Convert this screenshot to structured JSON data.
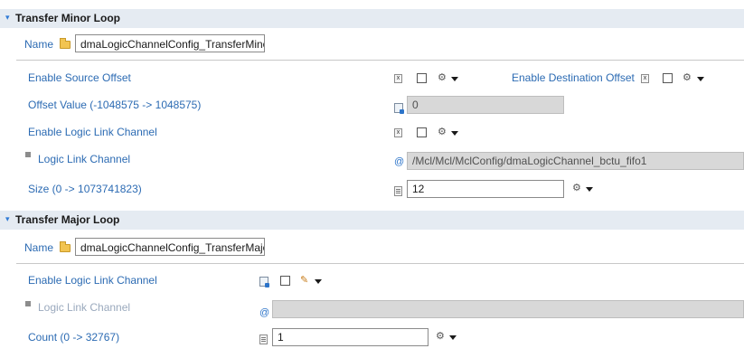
{
  "minor_loop": {
    "title": "Transfer Minor Loop",
    "name_label": "Name",
    "name_value": "dmaLogicChannelConfig_TransferMinor",
    "rows": {
      "enable_source_offset": "Enable Source Offset",
      "enable_destination_offset": "Enable Destination Offset",
      "offset_value": "Offset Value (-1048575 -> 1048575)",
      "offset_value_field": "0",
      "enable_logic_link_channel": "Enable Logic Link Channel",
      "logic_link_channel": "Logic Link Channel",
      "logic_link_channel_field": "/Mcl/Mcl/MclConfig/dmaLogicChannel_bctu_fifo1",
      "size": "Size (0 -> 1073741823)",
      "size_field": "12"
    }
  },
  "major_loop": {
    "title": "Transfer Major Loop",
    "name_label": "Name",
    "name_value": "dmaLogicChannelConfig_TransferMajor",
    "rows": {
      "enable_logic_link_channel": "Enable Logic Link Channel",
      "logic_link_channel": "Logic Link Channel",
      "logic_link_channel_field": "",
      "count": "Count (0 -> 32767)",
      "count_field": "1"
    }
  },
  "icons": {
    "expand": "▾",
    "x_marker": "x",
    "gear": "⚙",
    "pencil": "✎",
    "link": "@"
  }
}
